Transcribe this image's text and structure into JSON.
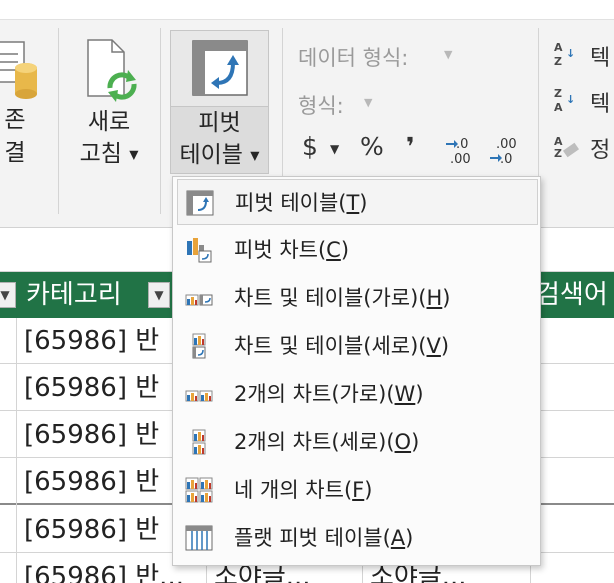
{
  "ribbon": {
    "connect_line1": "존",
    "connect_line2": "결",
    "refresh_line1": "새로",
    "refresh_line2": "고침",
    "pivot_line1": "피벗",
    "pivot_line2": "테이블",
    "data_type_label": "데이터 형식:",
    "format_label": "형식:",
    "currency": "$",
    "percent": "%",
    "comma": "❜",
    "sort_text1": "텍",
    "sort_text2": "텍",
    "sort_text3": "정"
  },
  "sheet": {
    "header_category": "카테고리",
    "header_keyword": "검색어",
    "rows": [
      {
        "cat": "[65986] 반"
      },
      {
        "cat": "[65986] 반"
      },
      {
        "cat": "[65986] 반"
      },
      {
        "cat": "[65986] 반"
      },
      {
        "cat": "[65986] 반"
      },
      {
        "cat": "[65986] 반...",
        "c2": "소야글...",
        "c3": "소야글..."
      }
    ]
  },
  "menu": {
    "items": [
      {
        "text": "피벗 테이블(",
        "key": "T",
        "icon": "pivot-table-icon"
      },
      {
        "text": "피벗 차트(",
        "key": "C",
        "icon": "pivot-chart-icon"
      },
      {
        "text": "차트 및 테이블(가로)(",
        "key": "H",
        "icon": "chart-and-table-horizontal-icon"
      },
      {
        "text": "차트 및 테이블(세로)(",
        "key": "V",
        "icon": "chart-and-table-vertical-icon"
      },
      {
        "text": "2개의 차트(가로)(",
        "key": "W",
        "icon": "two-charts-horizontal-icon"
      },
      {
        "text": "2개의 차트(세로)(",
        "key": "O",
        "icon": "two-charts-vertical-icon"
      },
      {
        "text": "네 개의 차트(",
        "key": "F",
        "icon": "four-charts-icon"
      },
      {
        "text": "플랫 피벗 테이블(",
        "key": "A",
        "icon": "flat-pivot-table-icon"
      }
    ],
    "close_paren": ")"
  },
  "colors": {
    "header_green": "#217346",
    "accent_blue": "#2e75b6",
    "refresh_green": "#4caf50"
  }
}
